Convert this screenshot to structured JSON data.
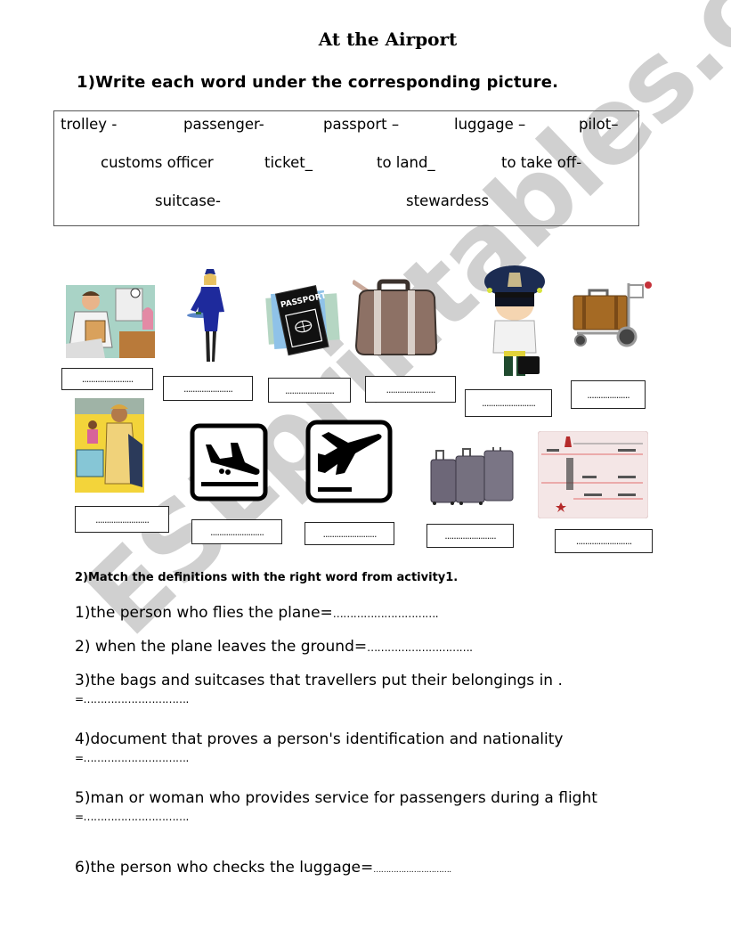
{
  "title": "At the Airport",
  "activity1": {
    "instruction": "1)Write each word under the corresponding picture.",
    "word_bank": [
      [
        "trolley  -",
        "passenger-",
        "passport –",
        "luggage –",
        "pilot–"
      ],
      [
        "customs officer",
        "ticket_",
        "to land_",
        "to take off-"
      ],
      [
        "suitcase-",
        "stewardess"
      ]
    ],
    "pictures": [
      {
        "subject": "customs-officer-illustration",
        "answer": "......................."
      },
      {
        "subject": "stewardess-clipart",
        "answer": "......................"
      },
      {
        "subject": "passport",
        "answer": "......................"
      },
      {
        "subject": "suitcase",
        "answer": "......................"
      },
      {
        "subject": "pilot-cartoon",
        "answer": "........................"
      },
      {
        "subject": "trolley-with-suitcase",
        "answer": "..................."
      },
      {
        "subject": "passenger-illustration",
        "answer": "........................"
      },
      {
        "subject": "landing-sign",
        "answer": "........................"
      },
      {
        "subject": "takeoff-sign",
        "answer": "........................"
      },
      {
        "subject": "luggage-set",
        "answer": "......................."
      },
      {
        "subject": "ticket",
        "answer": "........................."
      }
    ],
    "passport_label": "PASSPORT"
  },
  "activity2": {
    "instruction": "2)Match the definitions with the right word from activity1.",
    "definitions": [
      {
        "text": "1)the person who flies the plane=",
        "blank": "…………………………."
      },
      {
        "text": "2) when the plane leaves the ground=",
        "blank": "…………………………."
      },
      {
        "text": "3)the bags and suitcases that travellers put their belongings in .",
        "blank": "=…………………………."
      },
      {
        "text": "4)document that proves a person's identification and nationality",
        "blank": "=…………………………."
      },
      {
        "text": "5)man or woman who provides service for passengers during a flight",
        "blank": "=…………………………."
      },
      {
        "text": "6)the person who checks the luggage=",
        "blank": "…………………………."
      }
    ]
  },
  "watermark": "ESLprintables.com"
}
